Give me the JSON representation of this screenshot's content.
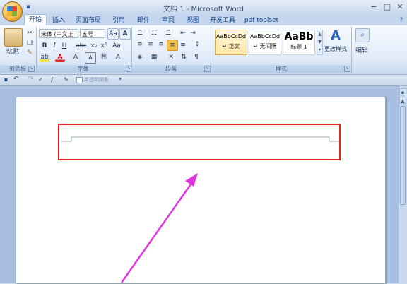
{
  "window": {
    "title": "文档 1 - Microsoft Word",
    "min_icon": "minimize-icon",
    "max_icon": "maximize-icon",
    "close_icon": "close-icon"
  },
  "tabs": [
    "开始",
    "插入",
    "页面布局",
    "引用",
    "邮件",
    "审阅",
    "视图",
    "开发工具",
    "pdf toolset"
  ],
  "clipboard": {
    "paste_label": "粘贴",
    "group_label": "剪贴板"
  },
  "font": {
    "font_name": "宋体 (中文正",
    "font_size": "五号",
    "bold": "B",
    "italic": "I",
    "underline": "U",
    "strike": "abc",
    "subscript": "x₂",
    "superscript": "x²",
    "aa_label": "Aa",
    "a_label": "A",
    "group_label": "字体"
  },
  "paragraph": {
    "group_label": "段落"
  },
  "styles": {
    "items": [
      {
        "preview": "AaBbCcDd",
        "name": "↵ 正文"
      },
      {
        "preview": "AaBbCcDd",
        "name": "↵ 无间隔"
      },
      {
        "preview": "AaBb",
        "name": "标题 1"
      }
    ],
    "change_styles_label": "更改样式",
    "group_label": "样式"
  },
  "editing": {
    "label": "编辑"
  },
  "qat": {
    "translucent_label": "半透明阴影"
  },
  "colors": {
    "highlight_border": "#e02424",
    "arrow": "#e033e0"
  }
}
